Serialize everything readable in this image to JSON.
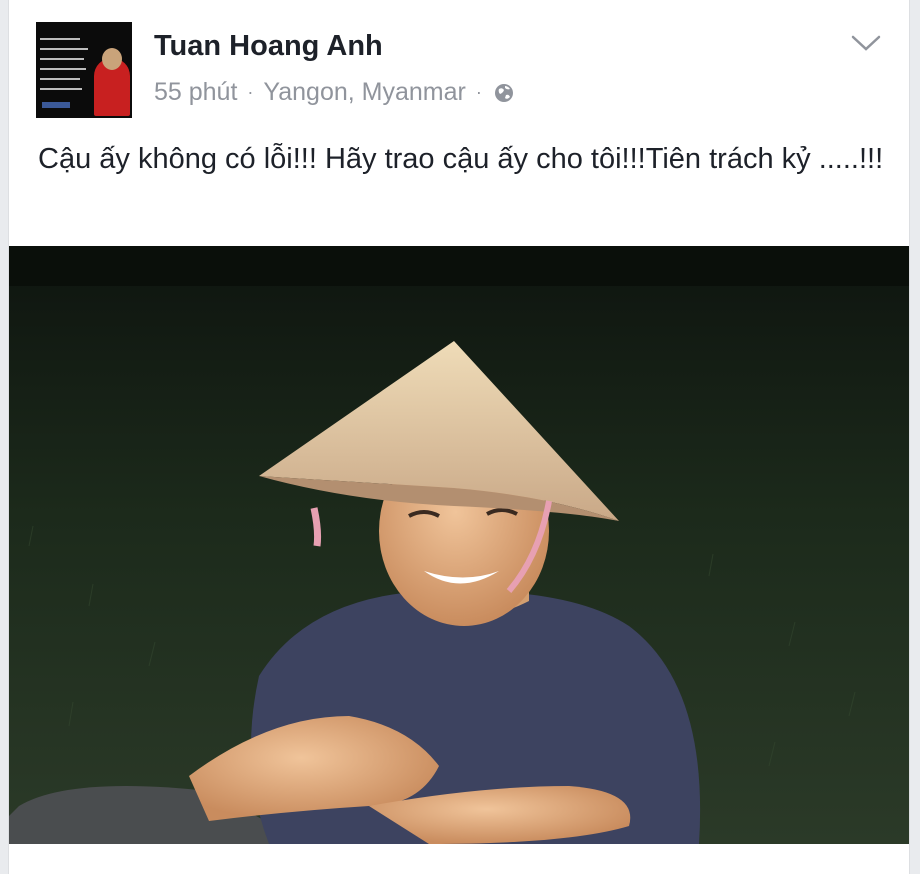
{
  "post": {
    "author": "Tuan Hoang Anh",
    "time": "55 phút",
    "separator": "·",
    "location": "Yangon, Myanmar",
    "caption": "Cậu ấy không có lỗi!!! Hãy trao cậu ấy cho tôi!!!Tiên trách kỷ .....!!!"
  },
  "icons": {
    "privacy": "globe-icon",
    "options": "chevron-down-icon"
  },
  "colors": {
    "name": "#1d2129",
    "meta": "#90949c",
    "background": "#e9ebee"
  }
}
